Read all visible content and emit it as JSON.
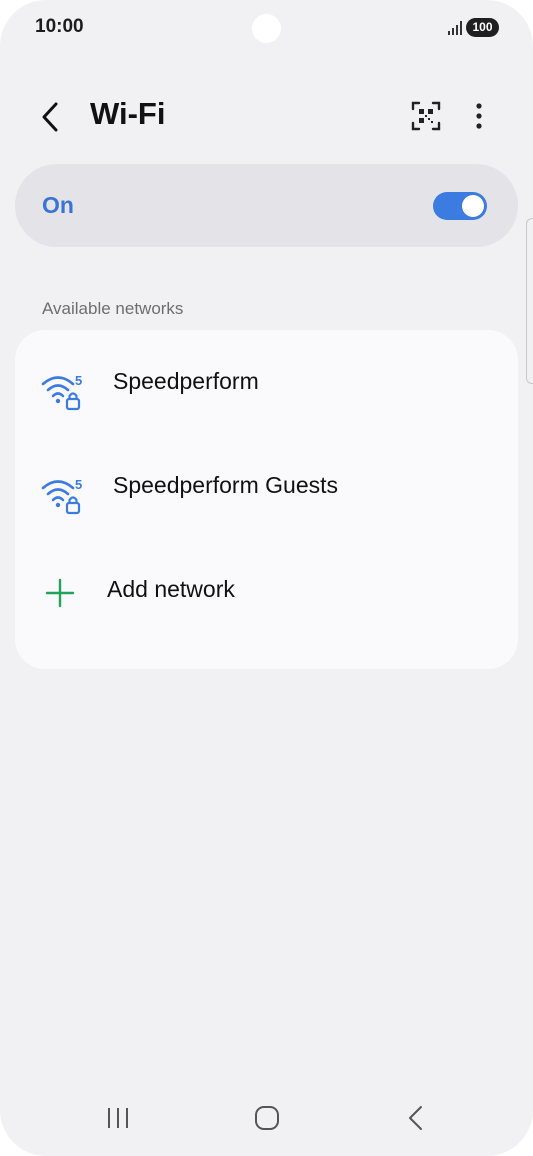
{
  "status_bar": {
    "time": "10:00",
    "battery": "100"
  },
  "header": {
    "title": "Wi-Fi"
  },
  "wifi_toggle": {
    "label": "On",
    "enabled": true,
    "accent_color": "#3c7be0"
  },
  "section_header": "Available networks",
  "networks": [
    {
      "name": "Speedperform",
      "icon": "wifi-5ghz-locked-icon"
    },
    {
      "name": "Speedperform Guests",
      "icon": "wifi-5ghz-locked-icon"
    }
  ],
  "add_network": {
    "label": "Add network",
    "icon": "plus-icon",
    "color": "#1fa45a"
  },
  "nav_bar": {
    "recents": "recents-icon",
    "home": "home-icon",
    "back": "back-icon"
  }
}
